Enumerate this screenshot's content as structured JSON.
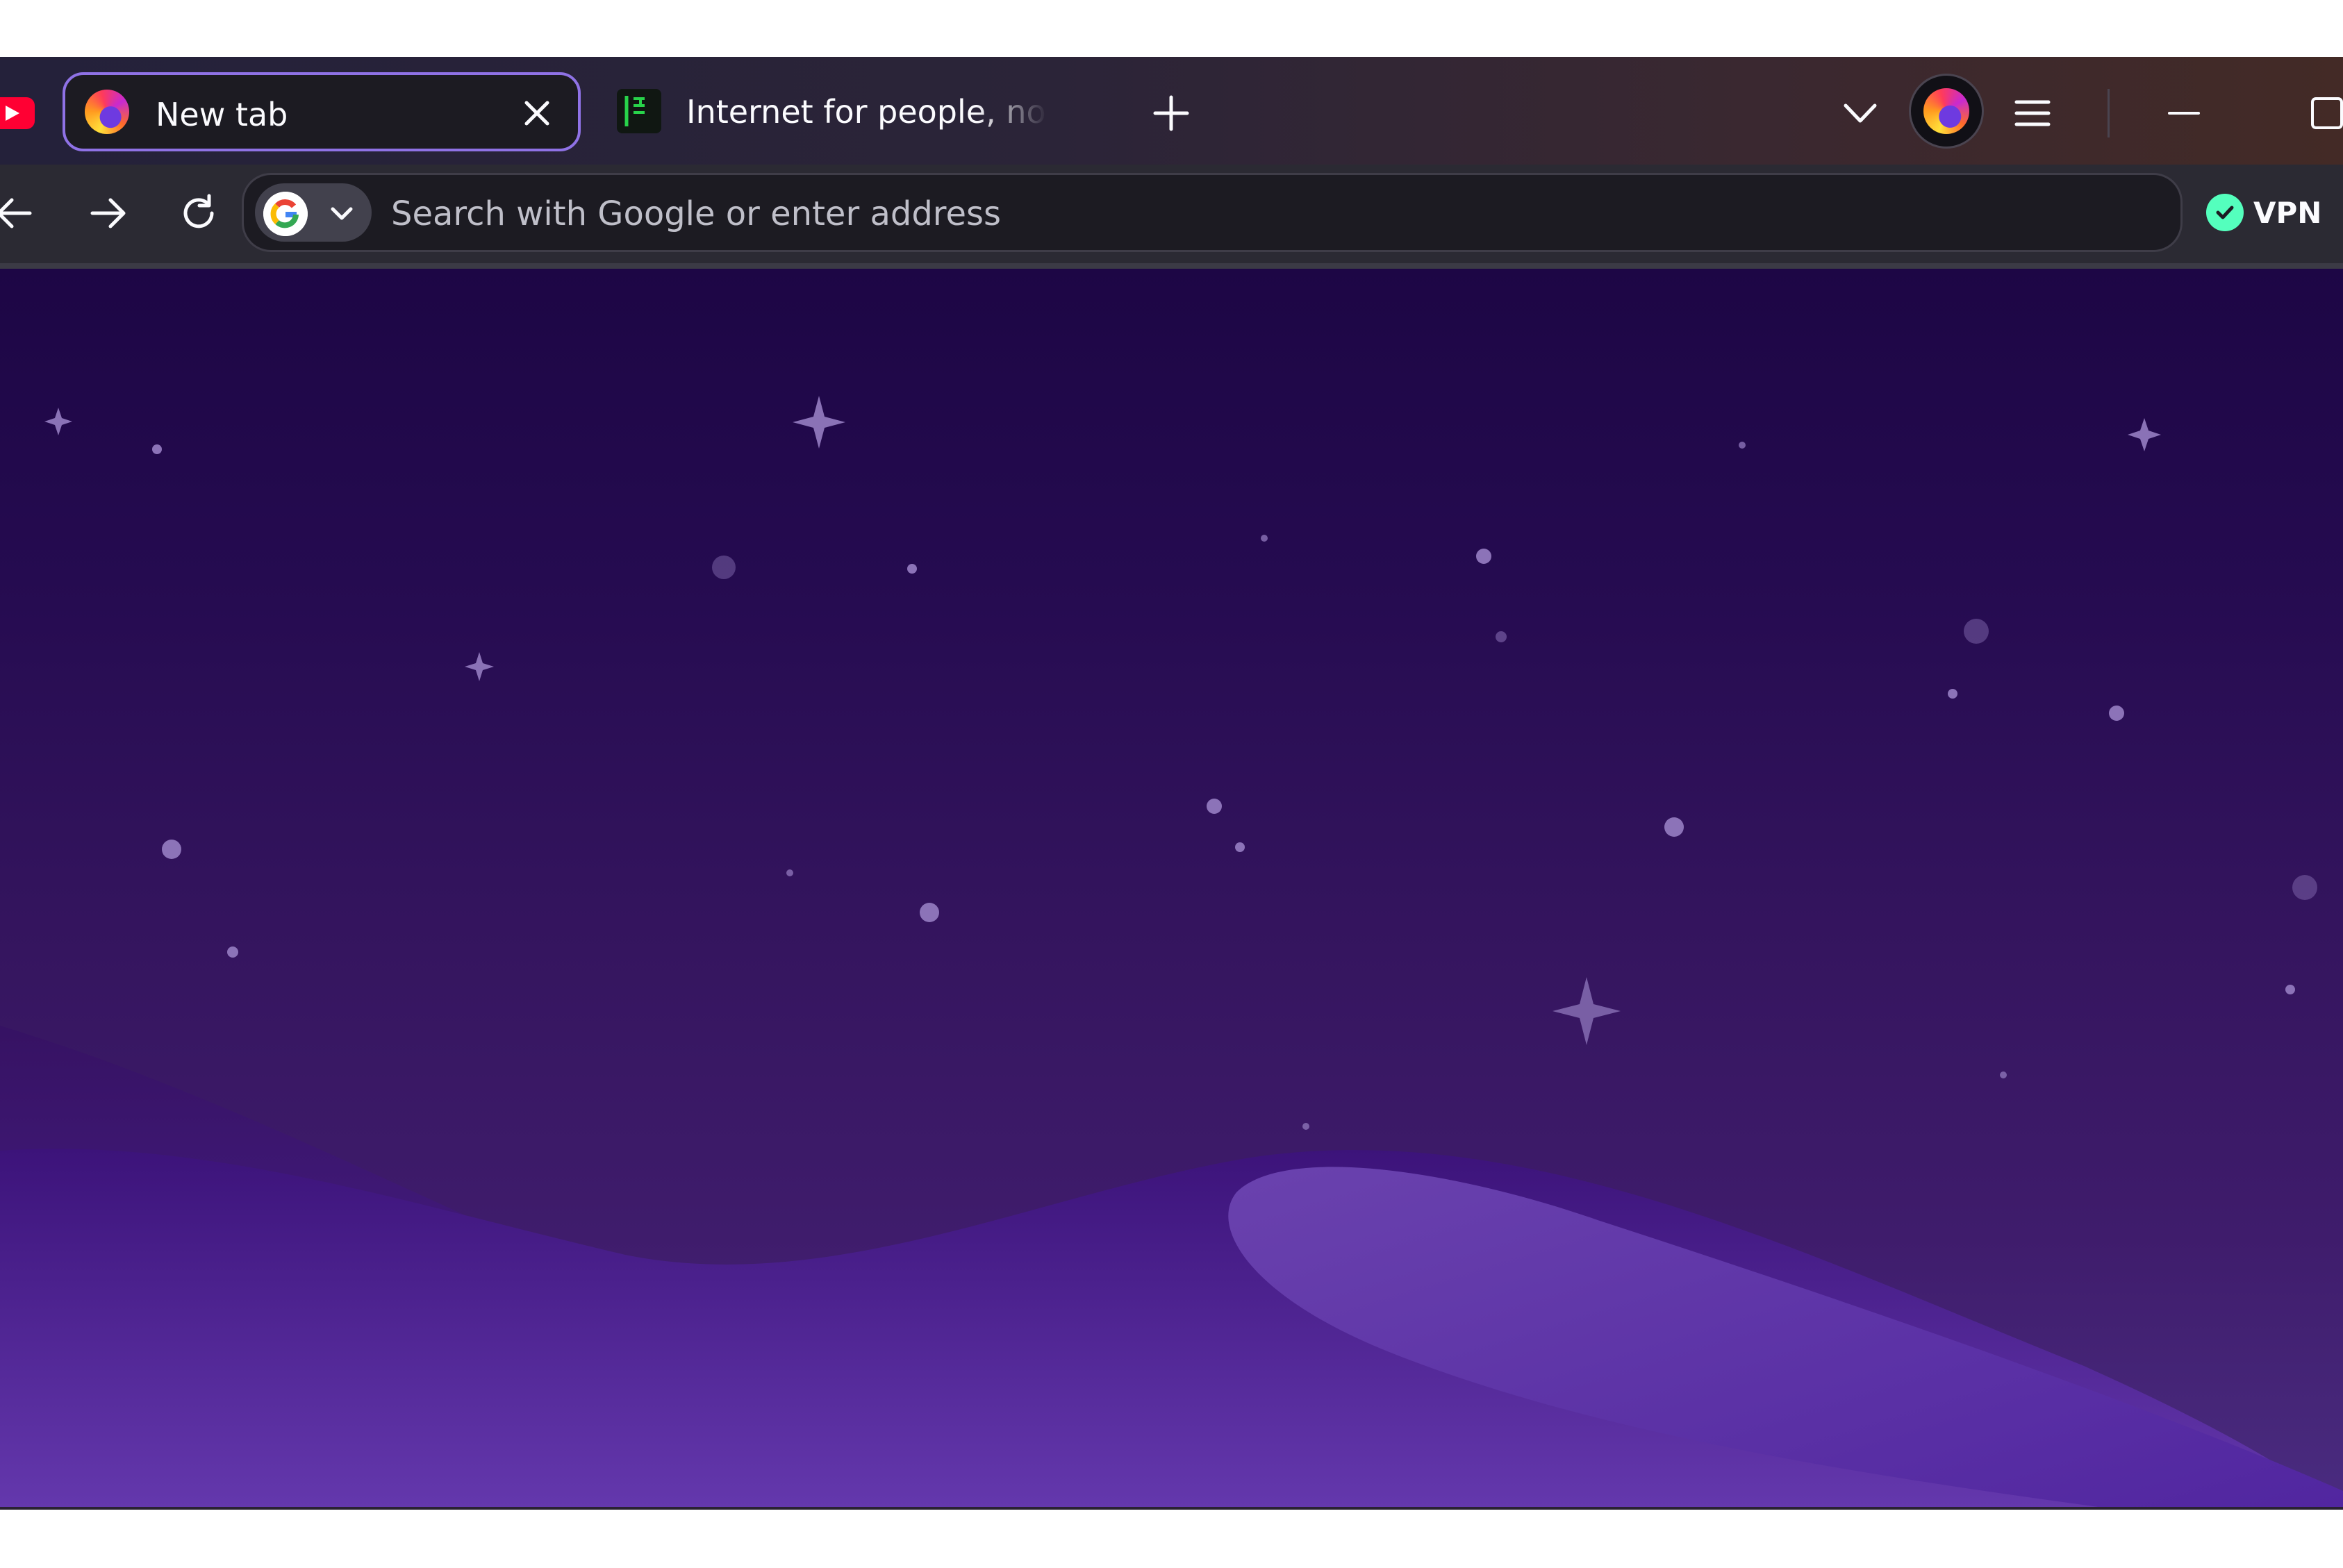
{
  "tabs": [
    {
      "label": "",
      "icon": "youtube-icon",
      "selected": false
    },
    {
      "label": "New tab",
      "icon": "firefox-icon",
      "selected": true
    },
    {
      "label": "Internet for people, no",
      "icon": "site-flag-icon",
      "selected": false
    }
  ],
  "navigation": {
    "search_placeholder": "Search with Google or enter address",
    "search_engine": "google-icon",
    "vpn_label": "VPN"
  },
  "colors": {
    "active_tab_border": "#8f72e6",
    "vpn_status": "#54ffbd",
    "youtube_red": "#ff0033",
    "wallpaper_top": "#1d0645",
    "wallpaper_bottom": "#4a2c80"
  }
}
